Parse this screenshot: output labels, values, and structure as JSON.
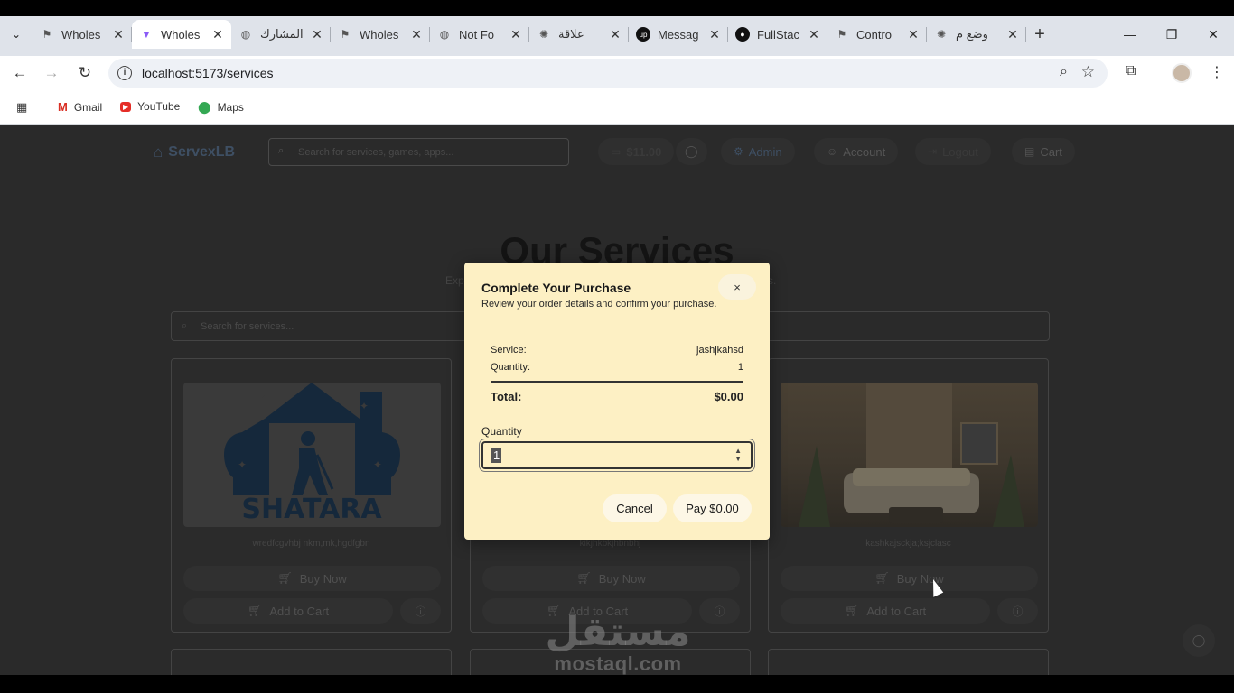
{
  "browser": {
    "tabs": [
      {
        "title": "Wholes",
        "icon": "wholesale-icon"
      },
      {
        "title": "Wholes",
        "icon": "vite-icon",
        "active": true
      },
      {
        "title": "المشارك",
        "icon": "globe-icon"
      },
      {
        "title": "Wholes",
        "icon": "wholesale-icon"
      },
      {
        "title": "Not Fo",
        "icon": "globe-icon"
      },
      {
        "title": "علاقة",
        "icon": "chatgpt-icon"
      },
      {
        "title": "Messag",
        "icon": "upwork-icon"
      },
      {
        "title": "FullStac",
        "icon": "github-icon"
      },
      {
        "title": "Contro",
        "icon": "wholesale-icon"
      },
      {
        "title": "وضع م",
        "icon": "chatgpt-icon"
      }
    ],
    "url": "localhost:5173/services",
    "bookmarks": [
      {
        "label": "Gmail",
        "icon": "gmail-icon"
      },
      {
        "label": "YouTube",
        "icon": "youtube-icon"
      },
      {
        "label": "Maps",
        "icon": "maps-icon"
      }
    ]
  },
  "site": {
    "logo": "ServexLB",
    "search_placeholder": "Search for services, games, apps...",
    "balance": "$11.00",
    "nav": {
      "admin": "Admin",
      "account": "Account",
      "logout": "Logout",
      "cart": "Cart"
    },
    "hero_title": "Our Services",
    "hero_sub_left": "Exp",
    "hero_sub_right": "s.",
    "services_search_placeholder": "Search for services...",
    "cards": [
      {
        "desc": "wredfcgvhbj nkm,mk,hgdfgbn",
        "buy": "Buy Now",
        "add": "Add to Cart",
        "brand": "SHATARA"
      },
      {
        "desc": "kikjhkbkjhbnbhj",
        "buy": "Buy Now",
        "add": "Add to Cart"
      },
      {
        "desc": "kashkajsckja;ksjclasc",
        "buy": "Buy Now",
        "add": "Add to Cart"
      }
    ]
  },
  "modal": {
    "title": "Complete Your Purchase",
    "subtitle": "Review your order details and confirm your purchase.",
    "service_label": "Service:",
    "service_value": "jashjkahsd",
    "quantity_label": "Quantity:",
    "quantity_value": "1",
    "total_label": "Total:",
    "total_value": "$0.00",
    "input_label": "Quantity",
    "input_value": "1",
    "cancel": "Cancel",
    "pay": "Pay $0.00",
    "close": "×"
  },
  "watermark": {
    "arabic": "مستقل",
    "latin": "mostaql.com"
  }
}
